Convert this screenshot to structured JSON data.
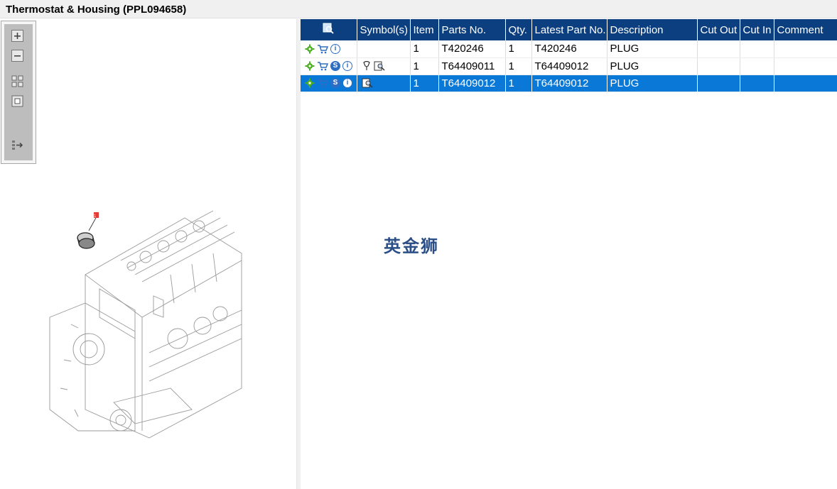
{
  "window": {
    "title": "Thermostat & Housing (PPL094658)"
  },
  "toolbar": {
    "buttons": [
      {
        "name": "zoom-in",
        "icon": "zoom-in-icon"
      },
      {
        "name": "zoom-out",
        "icon": "zoom-out-icon"
      },
      {
        "name": "fit-all",
        "icon": "fit-all-icon"
      },
      {
        "name": "actual-size",
        "icon": "actual-size-icon"
      },
      {
        "name": "toggle-panel",
        "icon": "panel-toggle-icon"
      }
    ]
  },
  "illustration": {
    "callout": "1"
  },
  "table": {
    "columns": [
      "",
      "Symbol(s)",
      "Item",
      "Parts No.",
      "Qty.",
      "Latest Part No.",
      "Description",
      "Cut Out",
      "Cut In",
      "Comment"
    ],
    "rows": [
      {
        "item": "1",
        "parts_no": "T420246",
        "qty": "1",
        "latest_part_no": "T420246",
        "description": "PLUG",
        "cut_out": "",
        "cut_in": "",
        "comment": "",
        "selected": false,
        "has_s": false,
        "symbols": []
      },
      {
        "item": "1",
        "parts_no": "T64409011",
        "qty": "1",
        "latest_part_no": "T64409012",
        "description": "PLUG",
        "cut_out": "",
        "cut_in": "",
        "comment": "",
        "selected": false,
        "has_s": true,
        "symbols": [
          "pin-icon",
          "view-icon"
        ]
      },
      {
        "item": "1",
        "parts_no": "T64409012",
        "qty": "1",
        "latest_part_no": "T64409012",
        "description": "PLUG",
        "cut_out": "",
        "cut_in": "",
        "comment": "",
        "selected": true,
        "has_s": true,
        "symbols": [
          "view-icon"
        ]
      }
    ],
    "row_icons": {
      "gear": "gear-icon",
      "cart": "cart-icon",
      "s_badge": "S",
      "info_badge": "i"
    }
  },
  "watermark": "英金狮",
  "colors": {
    "header_bg": "#0c3f7f",
    "selected_row": "#0a78d7",
    "gear_green": "#4caf1e"
  }
}
